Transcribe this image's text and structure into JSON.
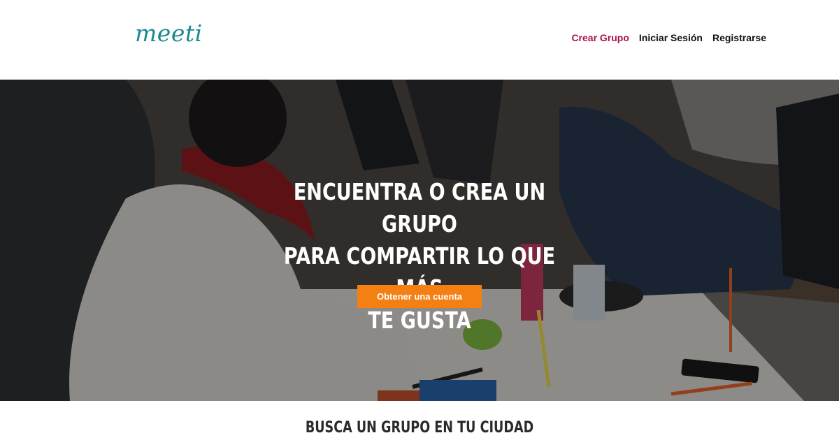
{
  "brand": {
    "logo_text": "meeti",
    "logo_color": "#1a8a8f"
  },
  "nav": [
    {
      "label": "Crear Grupo",
      "accent": true
    },
    {
      "label": "Iniciar Sesión",
      "accent": false
    },
    {
      "label": "Registrarse",
      "accent": false
    }
  ],
  "colors": {
    "accent": "#a8124f",
    "cta": "#f47f12"
  },
  "hero": {
    "title_lines": [
      "ENCUENTRA O CREA UN GRUPO",
      "PARA COMPARTIR LO QUE MÁS",
      "TE GUSTA"
    ],
    "cta_label": "Obtener una cuenta"
  },
  "search_section": {
    "title": "BUSCA UN GRUPO EN TU CIUDAD"
  }
}
